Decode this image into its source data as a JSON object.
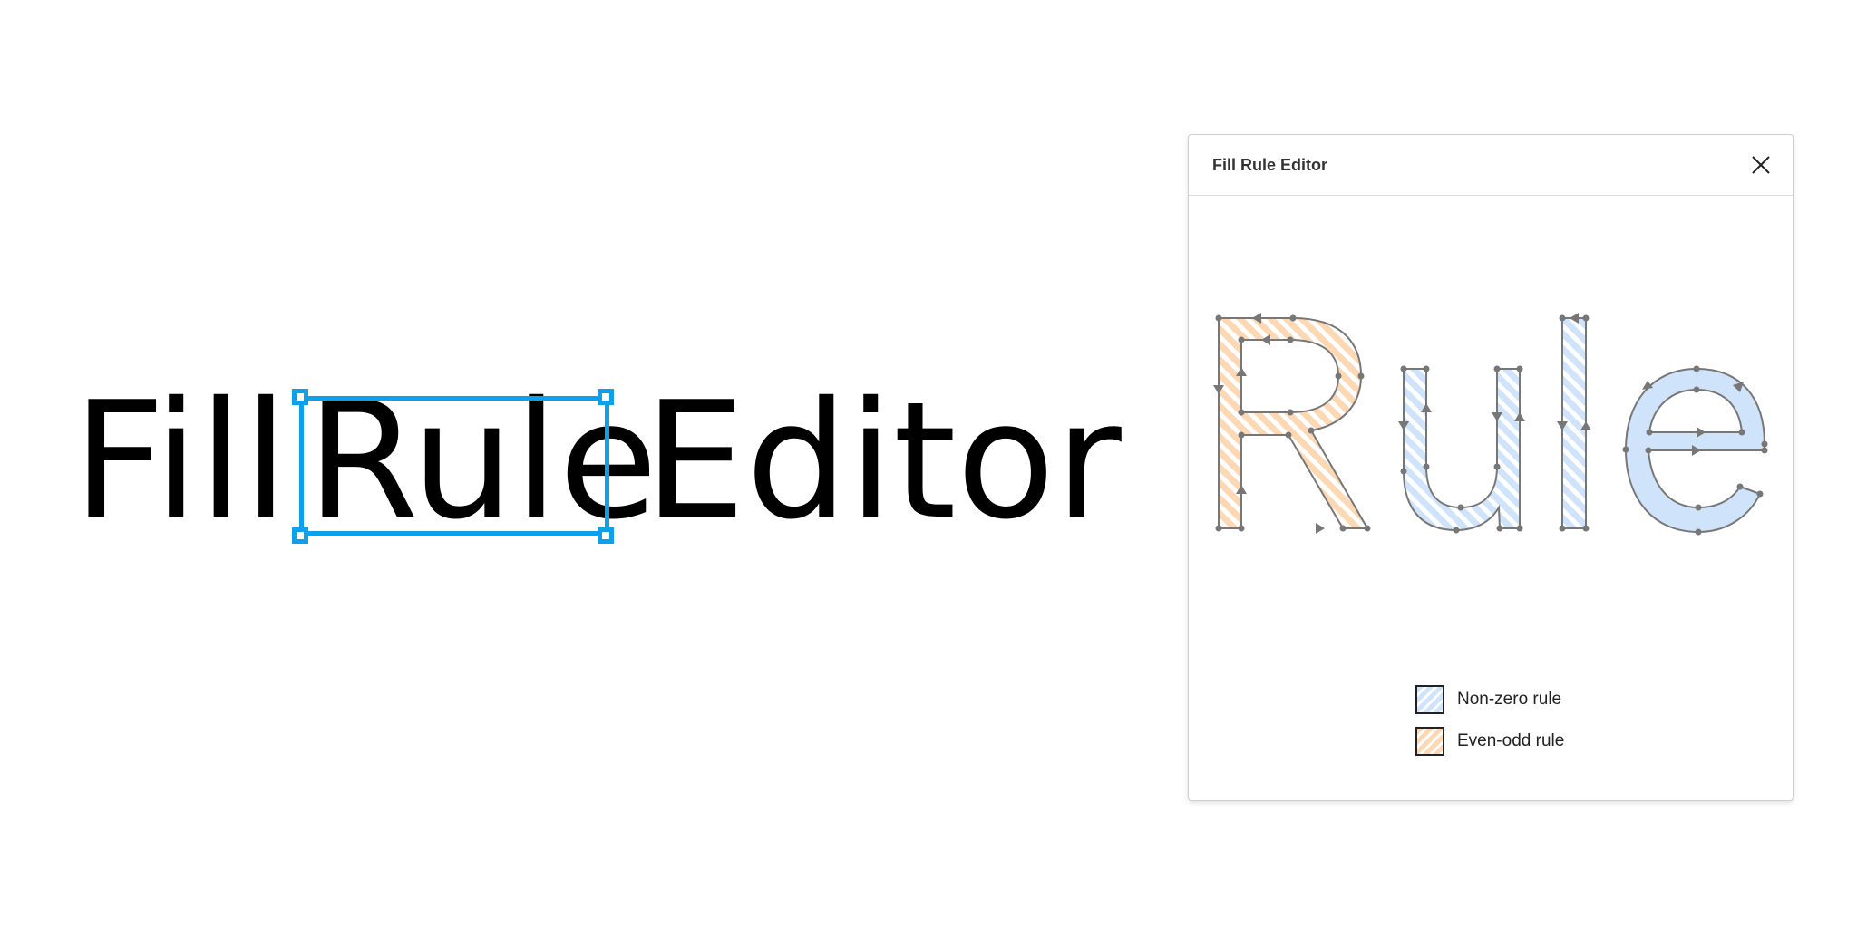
{
  "canvas": {
    "word_fill": "Fill",
    "word_rule": "Rule",
    "word_editor": "Editor"
  },
  "selection": {
    "color": "#0fa0ea"
  },
  "panel": {
    "title": "Fill Rule Editor",
    "close_icon": "close-icon",
    "preview_glyphs": [
      "R",
      "u",
      "l",
      "e"
    ],
    "legend": [
      {
        "label": "Non-zero rule",
        "color": "#cfe3fb"
      },
      {
        "label": "Even-odd rule",
        "color": "#fdd8b5"
      }
    ]
  }
}
